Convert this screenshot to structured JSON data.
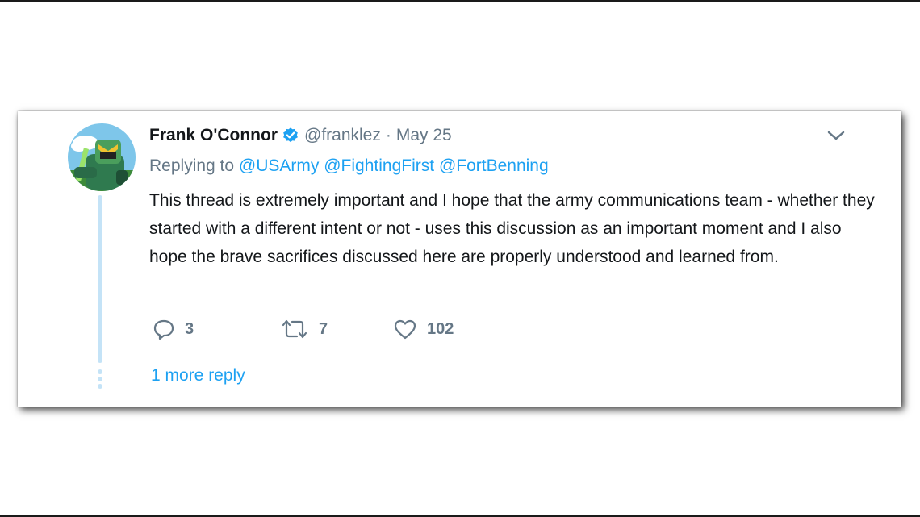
{
  "tweet": {
    "author_name": "Frank O'Connor",
    "handle": "@franklez",
    "separator": "·",
    "date": "May 25",
    "replying_prefix": "Replying to",
    "mentions": [
      "@USArmy",
      "@FightingFirst",
      "@FortBenning"
    ],
    "body": "This thread is extremely important and I hope that the army communications team - whether they started with a different intent or not - uses this discussion as an important moment and I also hope the brave sacrifices discussed here are properly understood and learned from.",
    "actions": {
      "replies": "3",
      "retweets": "7",
      "likes": "102"
    },
    "more_replies": "1 more reply"
  },
  "icons": {
    "verified": "verified-badge-icon",
    "caret": "chevron-down-icon",
    "reply": "reply-bubble-icon",
    "retweet": "retweet-icon",
    "like": "heart-icon"
  },
  "colors": {
    "link": "#1da1f2",
    "secondary": "#657786",
    "text": "#14171a",
    "thread_line": "#c4e3f7"
  }
}
